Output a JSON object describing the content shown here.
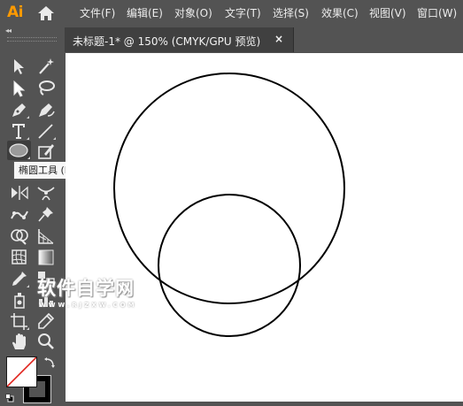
{
  "app": {
    "logo_text": "Ai"
  },
  "menu": {
    "items": [
      {
        "label": "文件(F)"
      },
      {
        "label": "编辑(E)"
      },
      {
        "label": "对象(O)"
      },
      {
        "label": "文字(T)"
      },
      {
        "label": "选择(S)"
      },
      {
        "label": "效果(C)"
      },
      {
        "label": "视图(V)"
      },
      {
        "label": "窗口(W)"
      }
    ]
  },
  "document": {
    "tab_title": "未标题-1* @ 150% (CMYK/GPU 预览)",
    "close_glyph": "×"
  },
  "toolbar": {
    "collapse_glyph": "◂◂",
    "selected_tool": "ellipse-tool",
    "tooltip": "椭圆工具 (L)",
    "tools": [
      "selection-tool",
      "magic-wand-tool",
      "direct-selection-tool",
      "lasso-tool",
      "pen-tool",
      "curvature-tool",
      "type-tool",
      "line-segment-tool",
      "ellipse-tool",
      "shaper-tool",
      "reflect-tool",
      "width-tool",
      "puppet-warp-tool",
      "pin-tool",
      "shape-builder-tool",
      "perspective-grid-tool",
      "mesh-tool",
      "gradient-tool",
      "eyedropper-tool",
      "blend-tool",
      "artboard-tool",
      "slice-tool",
      "hand-tool",
      "zoom-tool"
    ],
    "fill_color": "#ffffff",
    "stroke_color": "#000000"
  },
  "canvas": {
    "background": "#ffffff",
    "shapes": [
      {
        "type": "circle",
        "name": "large-circle",
        "stroke": "#000000",
        "fill": "none"
      },
      {
        "type": "circle",
        "name": "small-circle",
        "stroke": "#000000",
        "fill": "none"
      }
    ],
    "watermark": {
      "text": "软件自学网",
      "subtext": "WWW.RJZXW.COM"
    }
  },
  "colors": {
    "ui_dark": "#535353",
    "tab_bg": "#404040",
    "logo": "#ff9a00",
    "no_fill_slash": "#e0201a"
  }
}
